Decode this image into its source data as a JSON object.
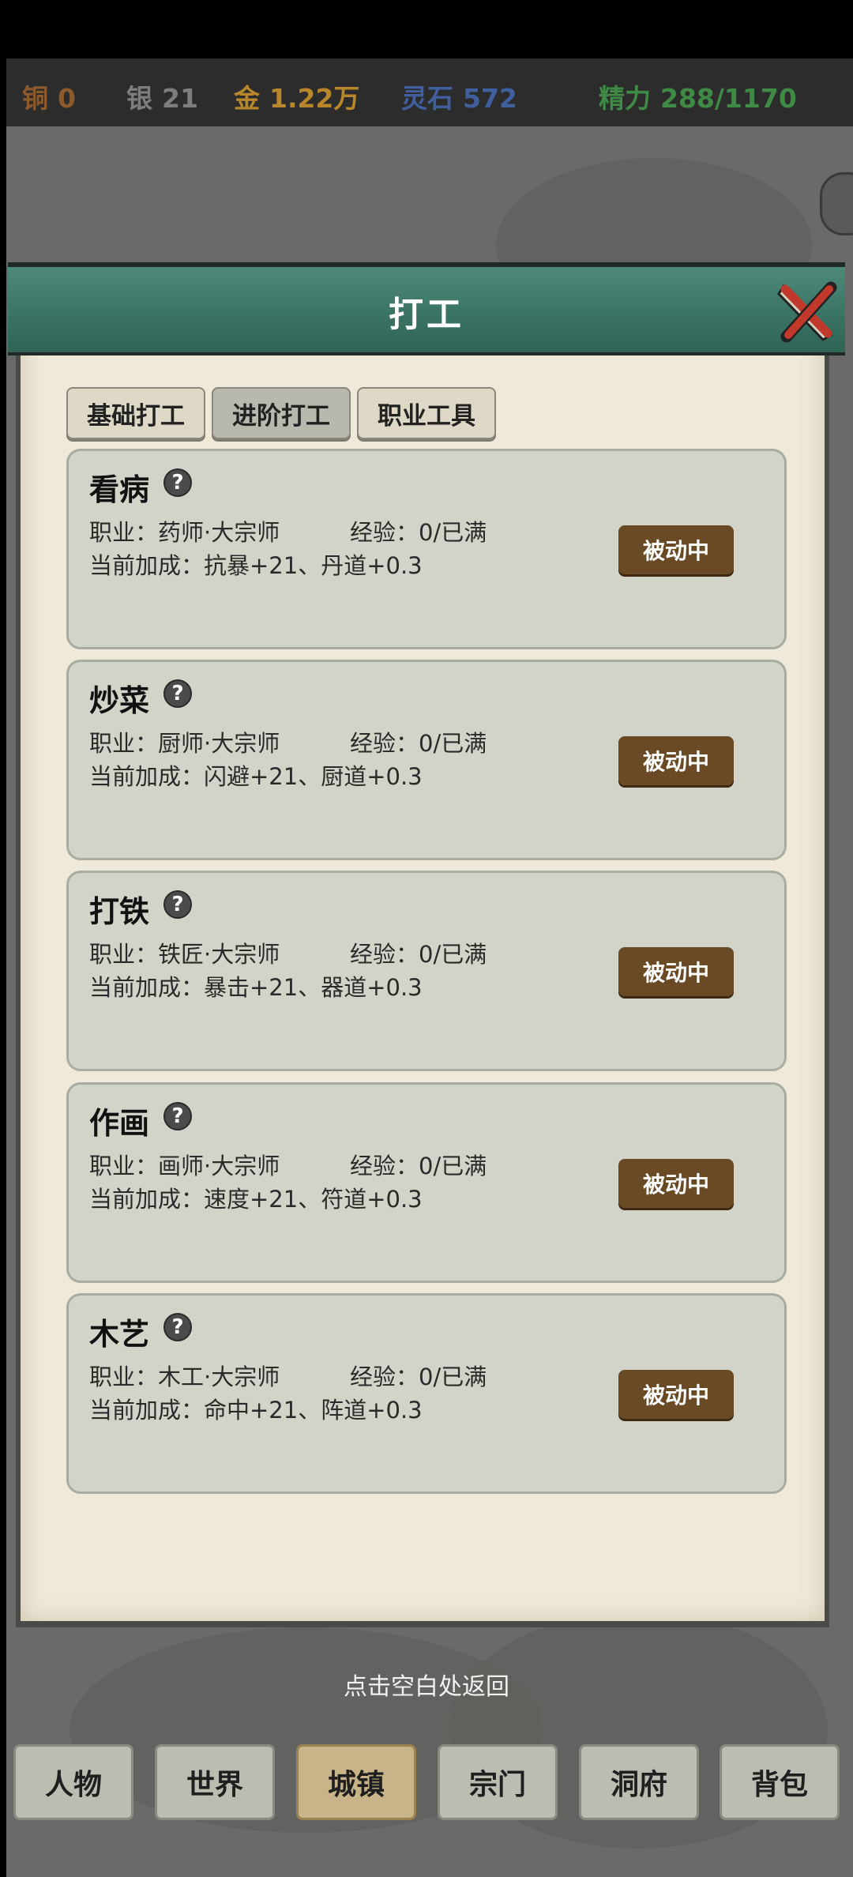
{
  "currency": {
    "copper": {
      "label": "铜",
      "value": "0"
    },
    "silver": {
      "label": "银",
      "value": "21"
    },
    "gold": {
      "label": "金",
      "value": "1.22万"
    },
    "spirit_stone": {
      "label": "灵石",
      "value": "572"
    },
    "energy": {
      "label": "精力",
      "value": "288/1170"
    }
  },
  "colors": {
    "copper": "#8c5a2b",
    "silver": "#7d7d7d",
    "gold": "#b8862b",
    "spirit_stone": "#3f5f9e",
    "energy": "#3f8a45"
  },
  "dialog": {
    "title": "打工",
    "close_icon": "close-x-icon"
  },
  "tabs": [
    {
      "label": "基础打工"
    },
    {
      "label": "进阶打工"
    },
    {
      "label": "职业工具"
    }
  ],
  "jobs": [
    {
      "name": "看病",
      "profession": "职业：药师·大宗师",
      "exp": "经验：0/已满",
      "bonus": "当前加成：抗暴+21、丹道+0.3",
      "status": "被动中"
    },
    {
      "name": "炒菜",
      "profession": "职业：厨师·大宗师",
      "exp": "经验：0/已满",
      "bonus": "当前加成：闪避+21、厨道+0.3",
      "status": "被动中"
    },
    {
      "name": "打铁",
      "profession": "职业：铁匠·大宗师",
      "exp": "经验：0/已满",
      "bonus": "当前加成：暴击+21、器道+0.3",
      "status": "被动中"
    },
    {
      "name": "作画",
      "profession": "职业：画师·大宗师",
      "exp": "经验：0/已满",
      "bonus": "当前加成：速度+21、符道+0.3",
      "status": "被动中"
    },
    {
      "name": "木艺",
      "profession": "职业：木工·大宗师",
      "exp": "经验：0/已满",
      "bonus": "当前加成：命中+21、阵道+0.3",
      "status": "被动中"
    }
  ],
  "help_glyph": "?",
  "hint": "点击空白处返回",
  "nav": [
    {
      "label": "人物"
    },
    {
      "label": "世界"
    },
    {
      "label": "城镇"
    },
    {
      "label": "宗门"
    },
    {
      "label": "洞府"
    },
    {
      "label": "背包"
    }
  ]
}
